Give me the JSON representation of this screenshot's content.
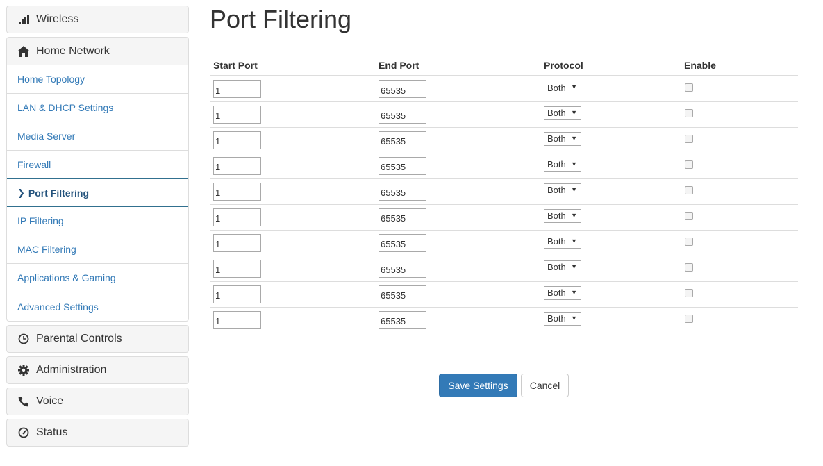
{
  "sidebar": {
    "wireless": "Wireless",
    "home_network": "Home Network",
    "items": [
      {
        "label": "Home Topology"
      },
      {
        "label": "LAN & DHCP Settings"
      },
      {
        "label": "Media Server"
      },
      {
        "label": "Firewall"
      },
      {
        "label": "Port Filtering",
        "active": true
      },
      {
        "label": "IP Filtering"
      },
      {
        "label": "MAC Filtering"
      },
      {
        "label": "Applications & Gaming"
      },
      {
        "label": "Advanced Settings"
      }
    ],
    "parental_controls": "Parental Controls",
    "administration": "Administration",
    "voice": "Voice",
    "status": "Status"
  },
  "page": {
    "title": "Port Filtering"
  },
  "table": {
    "headers": {
      "start_port": "Start Port",
      "end_port": "End Port",
      "protocol": "Protocol",
      "enable": "Enable"
    },
    "rows": [
      {
        "start": "1",
        "end": "65535",
        "protocol": "Both",
        "enabled": false
      },
      {
        "start": "1",
        "end": "65535",
        "protocol": "Both",
        "enabled": false
      },
      {
        "start": "1",
        "end": "65535",
        "protocol": "Both",
        "enabled": false
      },
      {
        "start": "1",
        "end": "65535",
        "protocol": "Both",
        "enabled": false
      },
      {
        "start": "1",
        "end": "65535",
        "protocol": "Both",
        "enabled": false
      },
      {
        "start": "1",
        "end": "65535",
        "protocol": "Both",
        "enabled": false
      },
      {
        "start": "1",
        "end": "65535",
        "protocol": "Both",
        "enabled": false
      },
      {
        "start": "1",
        "end": "65535",
        "protocol": "Both",
        "enabled": false
      },
      {
        "start": "1",
        "end": "65535",
        "protocol": "Both",
        "enabled": false
      },
      {
        "start": "1",
        "end": "65535",
        "protocol": "Both",
        "enabled": false
      }
    ]
  },
  "buttons": {
    "save": "Save Settings",
    "cancel": "Cancel"
  },
  "colors": {
    "primary": "#337ab7",
    "link": "#337ab7",
    "active_link": "#23527c"
  }
}
